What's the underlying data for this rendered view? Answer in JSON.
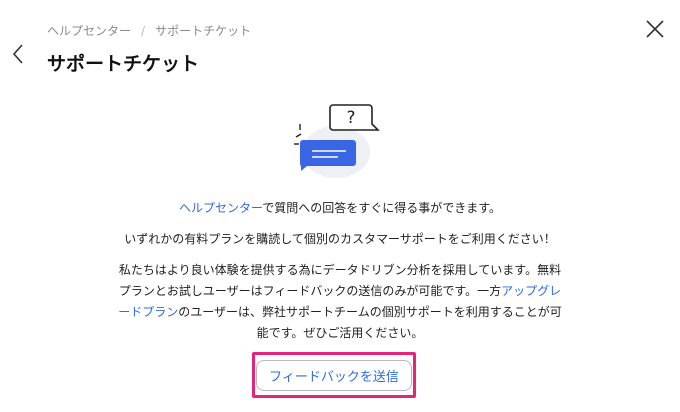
{
  "breadcrumb": {
    "items": [
      "ヘルプセンター",
      "サポートチケット"
    ],
    "separator": "/"
  },
  "header": {
    "title": "サポートチケット"
  },
  "content": {
    "para1": {
      "link": "ヘルプセンター",
      "text": "で質問への回答をすぐに得る事ができます。"
    },
    "para2": "いずれかの有料プランを購読して個別のカスタマーサポートをご利用ください！",
    "para3": {
      "line1": "私たちはより良い体験を提供する為にデータドリブン分析を採用しています。無料",
      "line2_before": "プランとお試しユーザーはフィードバックの送信のみが可能です。一方",
      "line2_link": "アップグレ",
      "line3_link": "ードプラン",
      "line3_after": "のユーザーは、弊社サポートチームの個別サポートを利用することが可",
      "line4": "能です。ぜひご活用ください。"
    },
    "feedback_button": "フィードバックを送信",
    "illustration_symbol": "?"
  },
  "colors": {
    "accent": "#2d6be4",
    "highlight": "#e6247a"
  },
  "icons": {
    "back": "chevron-left-icon",
    "close": "close-icon"
  }
}
